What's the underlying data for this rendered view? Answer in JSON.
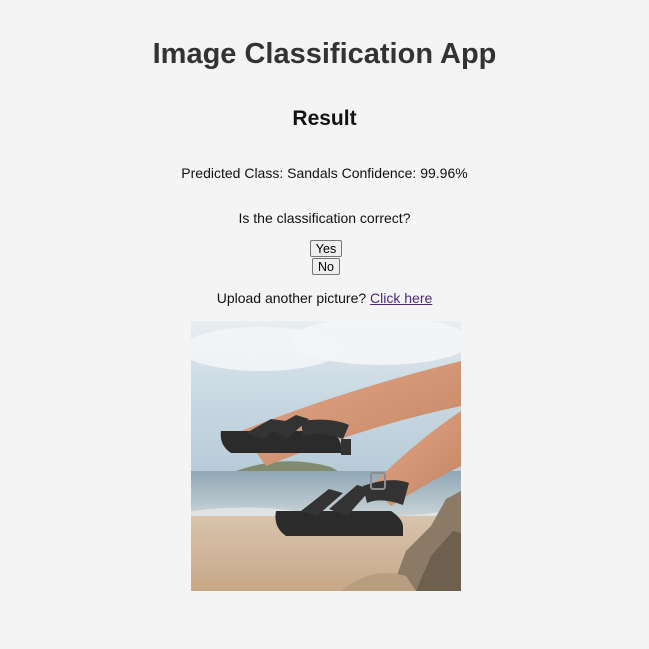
{
  "app": {
    "title": "Image Classification App"
  },
  "result": {
    "heading": "Result",
    "prediction_text": "Predicted Class: Sandals Confidence: 99.96%"
  },
  "feedback": {
    "question": "Is the classification correct?",
    "yes_label": "Yes",
    "no_label": "No"
  },
  "upload": {
    "prompt": "Upload another picture? ",
    "link_label": "Click here"
  },
  "colors": {
    "background": "#f4f4f4",
    "title": "#333333",
    "link": "#4a2a7a"
  }
}
